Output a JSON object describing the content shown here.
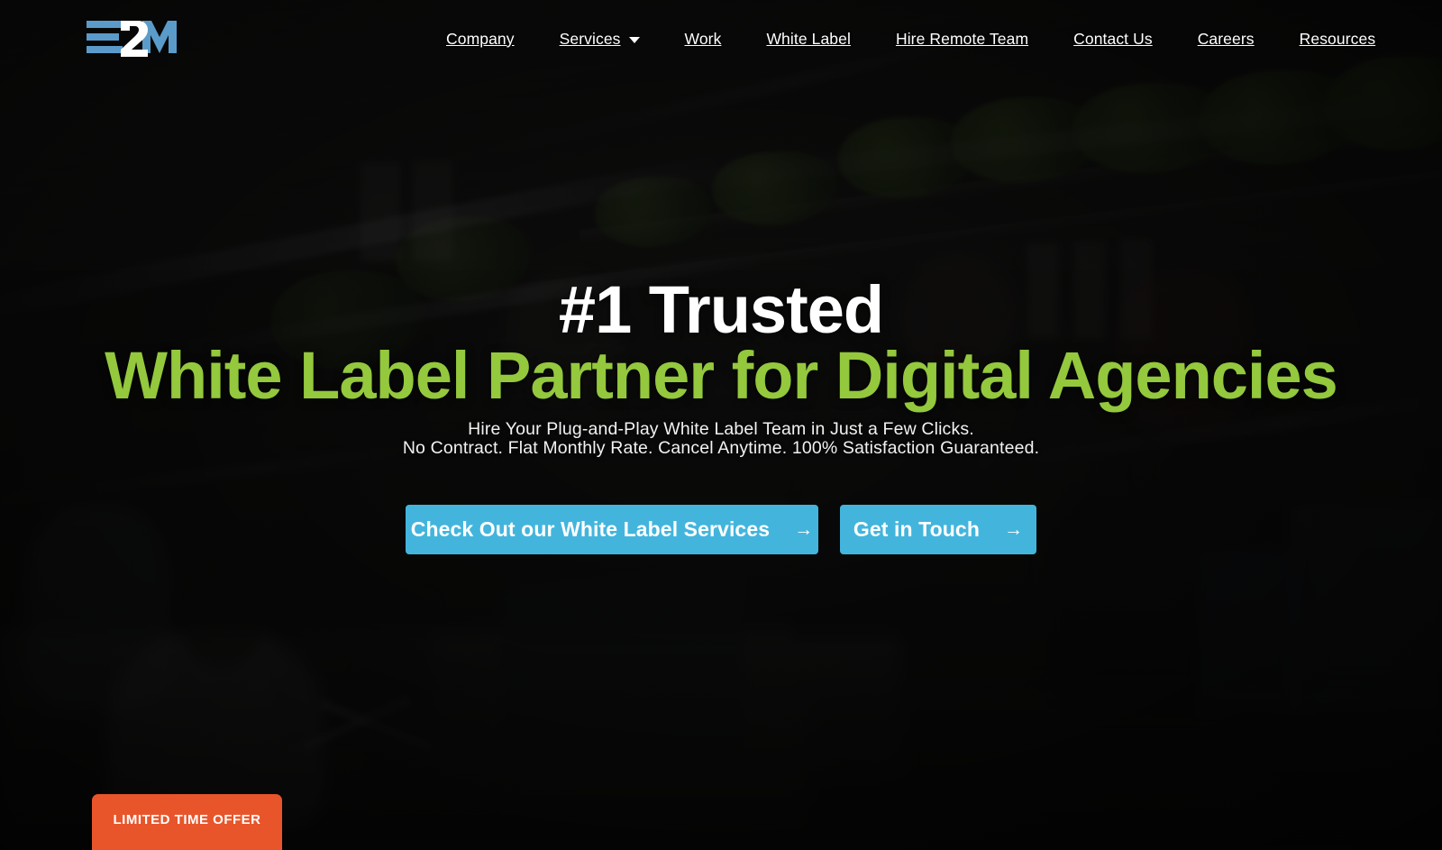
{
  "brand": {
    "logo_text": "E2M",
    "logo_blue": "#5a9bc9",
    "logo_white": "#ffffff"
  },
  "colors": {
    "accent_green": "#94c83d",
    "accent_blue": "#43b5dd",
    "accent_orange": "#e8552a",
    "text_white": "#ffffff",
    "hero_bg_dark": "#1a1a18"
  },
  "nav": {
    "items": [
      {
        "label": "Company",
        "has_dropdown": false
      },
      {
        "label": "Services",
        "has_dropdown": true
      },
      {
        "label": "Work",
        "has_dropdown": false
      },
      {
        "label": "White Label",
        "has_dropdown": false
      },
      {
        "label": "Hire Remote Team",
        "has_dropdown": false
      },
      {
        "label": "Contact Us",
        "has_dropdown": false
      },
      {
        "label": "Careers",
        "has_dropdown": false
      },
      {
        "label": "Resources",
        "has_dropdown": false
      }
    ]
  },
  "hero": {
    "headline_line1": "#1 Trusted",
    "headline_line2": "White Label Partner for Digital Agencies",
    "subline_1": "Hire Your Plug-and-Play White Label Team in Just a Few Clicks.",
    "subline_2": "No Contract. Flat Monthly Rate. Cancel Anytime. 100% Satisfaction Guaranteed.",
    "cta_primary": "Check Out our White Label Services",
    "cta_secondary": "Get in Touch",
    "cta_arrow": "→"
  },
  "offer": {
    "badge_label": "LIMITED TIME OFFER"
  }
}
